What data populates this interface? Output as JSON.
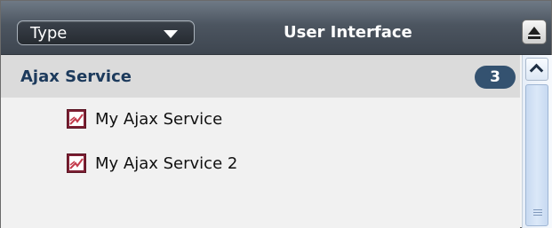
{
  "panel": {
    "type_select": {
      "value": "Type"
    },
    "title": "User Interface",
    "collapse_icon": "collapse-up-icon"
  },
  "group": {
    "title": "Ajax Service",
    "count": "3",
    "items": [
      {
        "label": "My Ajax Service",
        "icon": "ajax-service-icon"
      },
      {
        "label": "My Ajax Service 2",
        "icon": "ajax-service-icon"
      }
    ]
  },
  "scrollbar": {
    "up_icon": "chevron-up-icon",
    "grip_icon": "grip-icon"
  },
  "colors": {
    "titlebar": "#4c5560",
    "group_header_bg": "#dbdbdb",
    "group_title": "#1c3a5c",
    "badge_bg": "#345270",
    "list_bg": "#f1f1f1",
    "scrollbar": "#dbe8f8"
  }
}
